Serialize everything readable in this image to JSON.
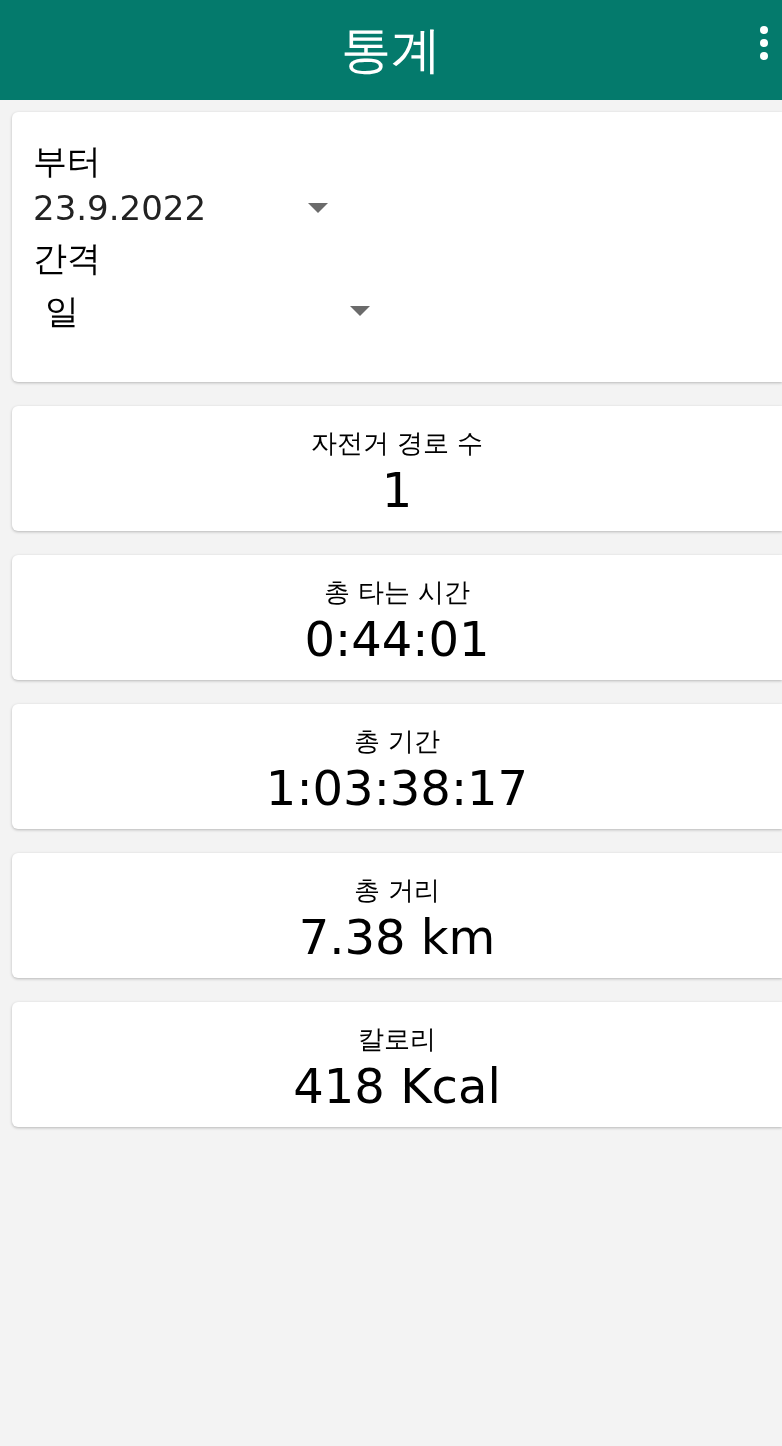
{
  "app_bar": {
    "title": "통계"
  },
  "filter": {
    "from_label": "부터",
    "from_value": "23.9.2022",
    "interval_label": "간격",
    "interval_value": "일"
  },
  "stats": [
    {
      "label": "자전거 경로 수",
      "value": "1"
    },
    {
      "label": "총 타는 시간",
      "value": "0:44:01"
    },
    {
      "label": "총 기간",
      "value": "1:03:38:17"
    },
    {
      "label": "총 거리",
      "value": "7.38 km"
    },
    {
      "label": "칼로리",
      "value": "418 Kcal"
    }
  ]
}
